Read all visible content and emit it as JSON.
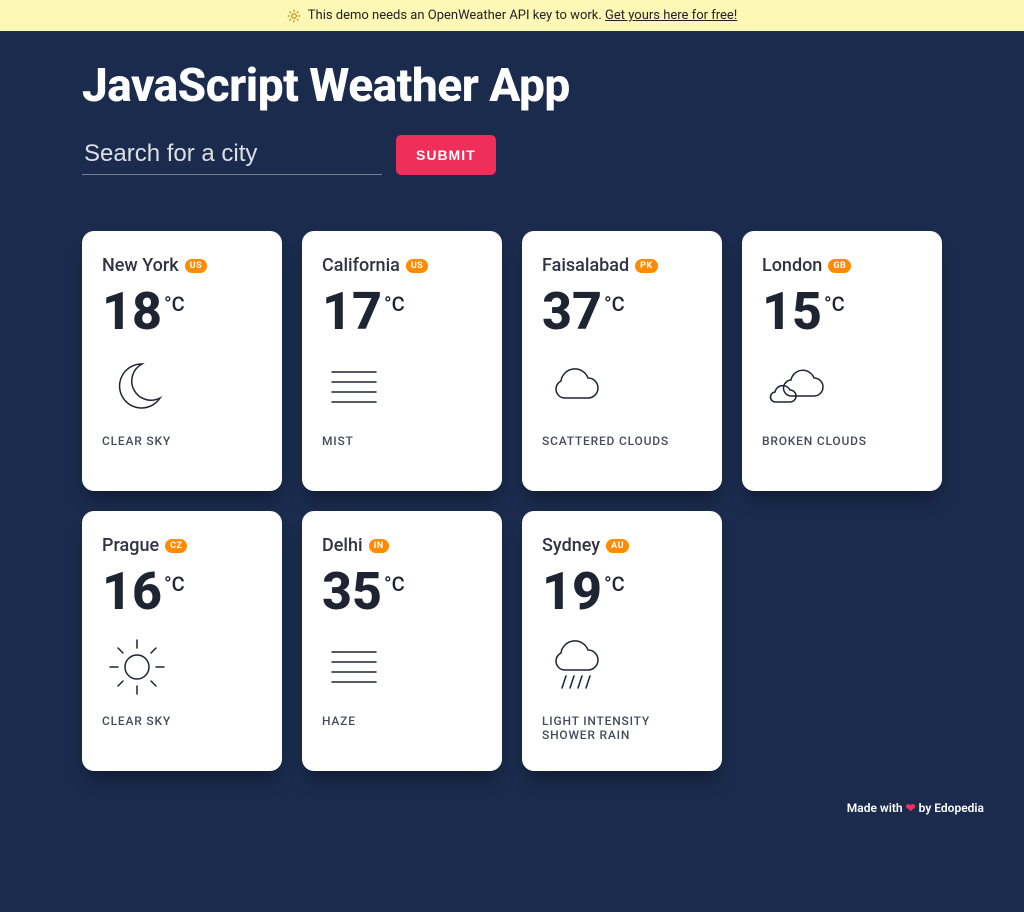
{
  "banner": {
    "text_prefix": "This demo needs an OpenWeather API key to work. ",
    "link_text": "Get yours here for free!"
  },
  "header": {
    "title": "JavaScript Weather App"
  },
  "search": {
    "placeholder": "Search for a city",
    "submit_label": "SUBMIT"
  },
  "temp_unit": "°C",
  "cards": [
    {
      "city": "New York",
      "country": "US",
      "temp": "18",
      "desc": "CLEAR SKY",
      "icon": "moon"
    },
    {
      "city": "California",
      "country": "US",
      "temp": "17",
      "desc": "MIST",
      "icon": "mist"
    },
    {
      "city": "Faisalabad",
      "country": "PK",
      "temp": "37",
      "desc": "SCATTERED CLOUDS",
      "icon": "cloud"
    },
    {
      "city": "London",
      "country": "GB",
      "temp": "15",
      "desc": "BROKEN CLOUDS",
      "icon": "clouds"
    },
    {
      "city": "Prague",
      "country": "CZ",
      "temp": "16",
      "desc": "CLEAR SKY",
      "icon": "sun"
    },
    {
      "city": "Delhi",
      "country": "IN",
      "temp": "35",
      "desc": "HAZE",
      "icon": "mist"
    },
    {
      "city": "Sydney",
      "country": "AU",
      "temp": "19",
      "desc": "LIGHT INTENSITY SHOWER RAIN",
      "icon": "rain"
    }
  ],
  "footer": {
    "prefix": "Made with ",
    "heart": "❤",
    "suffix": " by Edopedia"
  }
}
